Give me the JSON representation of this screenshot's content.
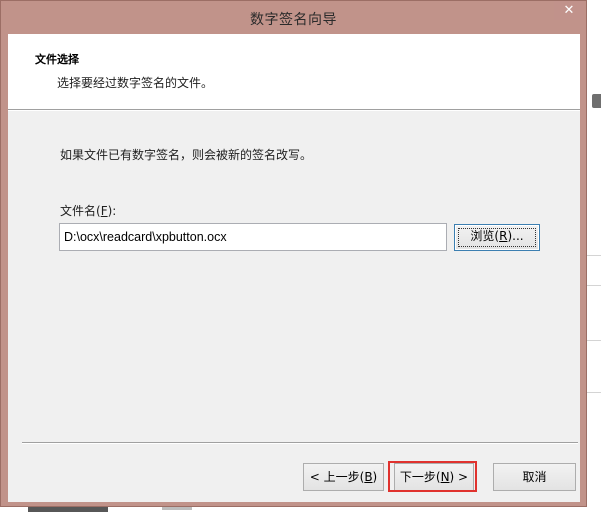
{
  "window": {
    "title": "数字签名向导",
    "close_glyph": "✕"
  },
  "header": {
    "title": "文件选择",
    "subtitle": "选择要经过数字签名的文件。"
  },
  "body": {
    "info_text": "如果文件已有数字签名，则会被新的签名改写。",
    "filename_label_prefix": "文件名(",
    "filename_label_key": "F",
    "filename_label_suffix": "):",
    "filename_value": "D:\\ocx\\readcard\\xpbutton.ocx"
  },
  "buttons": {
    "browse": {
      "prefix": "浏览(",
      "key": "R",
      "suffix": ")..."
    },
    "back": {
      "prefix": "< 上一步(",
      "key": "B",
      "suffix": ")"
    },
    "next": {
      "prefix": "下一步(",
      "key": "N",
      "suffix": ") >"
    },
    "cancel": {
      "label": "取消"
    }
  },
  "colors": {
    "titlebar": "#c1938a",
    "highlight": "#e0322e"
  }
}
